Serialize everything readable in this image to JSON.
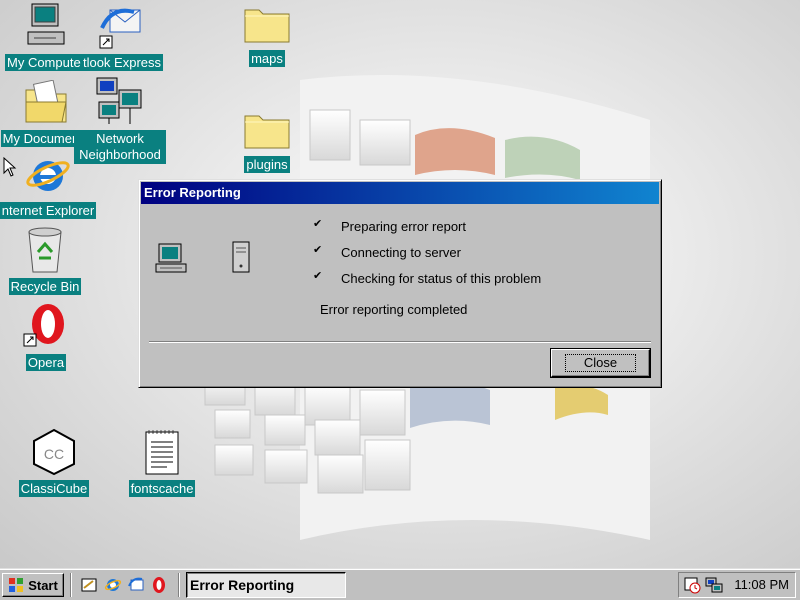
{
  "desktop": {
    "icons": [
      {
        "name": "my-computer",
        "label": "My Computer"
      },
      {
        "name": "outlook-express",
        "label": "tlook Express"
      },
      {
        "name": "maps-folder",
        "label": "maps"
      },
      {
        "name": "my-documents",
        "label": "My Documents"
      },
      {
        "name": "network-neighborhood",
        "label": "Network Neighborhood"
      },
      {
        "name": "plugins-folder",
        "label": "plugins"
      },
      {
        "name": "internet-explorer",
        "label": "nternet Explorer"
      },
      {
        "name": "recycle-bin",
        "label": "Recycle Bin"
      },
      {
        "name": "opera",
        "label": "Opera"
      },
      {
        "name": "classicube",
        "label": "ClassiCube"
      },
      {
        "name": "fontscache",
        "label": "fontscache"
      }
    ]
  },
  "dialog": {
    "title": "Error Reporting",
    "steps": [
      {
        "mark": "✔",
        "text": "Preparing error report"
      },
      {
        "mark": "✔",
        "text": "Connecting to server"
      },
      {
        "mark": "✔",
        "text": "Checking for status of this problem"
      }
    ],
    "status": "Error reporting completed",
    "close_label": "Close"
  },
  "taskbar": {
    "start_label": "Start",
    "task_label": "Error Reporting",
    "clock": "11:08 PM",
    "quick_launch": [
      "show-desktop-icon",
      "internet-explorer-icon",
      "outlook-express-icon",
      "opera-icon"
    ]
  },
  "colors": {
    "desktop_label_bg": "#0a8080",
    "titlebar_start": "#000080",
    "titlebar_end": "#1084d0",
    "window_face": "#c0c0c0"
  }
}
